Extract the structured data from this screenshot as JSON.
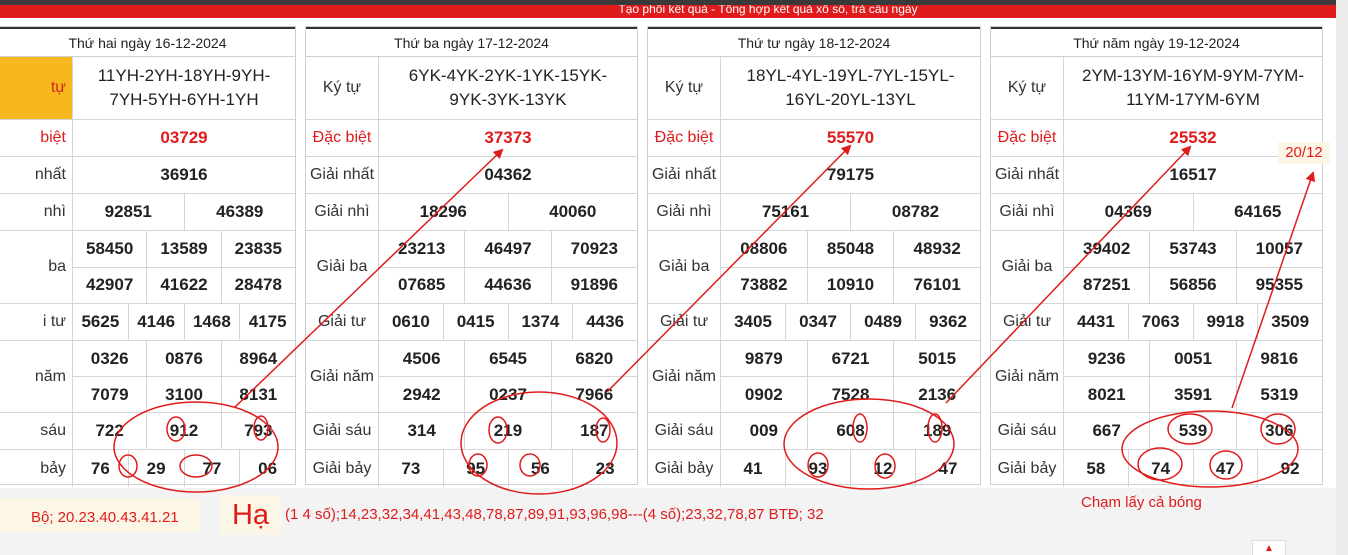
{
  "header": {
    "banner_text": "Tạo phôi kết quả - Tổng hợp kết quả xổ số, trả cầu ngày"
  },
  "labels": {
    "ky_tu": "Ký tự",
    "dac_biet": "Đặc biệt",
    "giai_nhat": "Giải nhất",
    "giai_nhi": "Giải nhì",
    "giai_ba": "Giải ba",
    "giai_tu": "Giải tư",
    "giai_nam": "Giải năm",
    "giai_sau": "Giải sáu",
    "giai_bay": "Giải bảy"
  },
  "first_labels": {
    "ky_tu": "tự",
    "dac_biet": "biệt",
    "giai_nhat": "nhất",
    "giai_nhi": "nhì",
    "giai_ba": "ba",
    "giai_tu": "i tư",
    "giai_nam": "năm",
    "giai_sau": "sáu",
    "giai_bay": "bảy"
  },
  "cards": [
    {
      "date": "Thứ hai ngày 16-12-2024",
      "ky_tu": "11YH-2YH-18YH-9YH-7YH-5YH-6YH-1YH",
      "dac_biet": "03729",
      "giai_nhat": "36916",
      "giai_nhi": [
        "92851",
        "46389"
      ],
      "giai_ba": [
        "58450",
        "13589",
        "23835",
        "42907",
        "41622",
        "28478"
      ],
      "giai_tu": [
        "5625",
        "4146",
        "1468",
        "4175"
      ],
      "giai_nam": [
        "0326",
        "0876",
        "8964",
        "7079",
        "3100",
        "8131"
      ],
      "giai_sau": [
        "722",
        "912",
        "793"
      ],
      "giai_bay": [
        "76",
        "29",
        "77",
        "06"
      ]
    },
    {
      "date": "Thứ ba ngày 17-12-2024",
      "ky_tu": "6YK-4YK-2YK-1YK-15YK-9YK-3YK-13YK",
      "dac_biet": "37373",
      "giai_nhat": "04362",
      "giai_nhi": [
        "18296",
        "40060"
      ],
      "giai_ba": [
        "23213",
        "46497",
        "70923",
        "07685",
        "44636",
        "91896"
      ],
      "giai_tu": [
        "0610",
        "0415",
        "1374",
        "4436"
      ],
      "giai_nam": [
        "4506",
        "6545",
        "6820",
        "2942",
        "0237",
        "7966"
      ],
      "giai_sau": [
        "314",
        "219",
        "187"
      ],
      "giai_bay": [
        "73",
        "95",
        "56",
        "23"
      ]
    },
    {
      "date": "Thứ tư ngày 18-12-2024",
      "ky_tu": "18YL-4YL-19YL-7YL-15YL-16YL-20YL-13YL",
      "dac_biet": "55570",
      "giai_nhat": "79175",
      "giai_nhi": [
        "75161",
        "08782"
      ],
      "giai_ba": [
        "08806",
        "85048",
        "48932",
        "73882",
        "10910",
        "76101"
      ],
      "giai_tu": [
        "3405",
        "0347",
        "0489",
        "9362"
      ],
      "giai_nam": [
        "9879",
        "6721",
        "5015",
        "0902",
        "7528",
        "2136"
      ],
      "giai_sau": [
        "009",
        "608",
        "189"
      ],
      "giai_bay": [
        "41",
        "93",
        "12",
        "47"
      ]
    },
    {
      "date": "Thứ năm ngày 19-12-2024",
      "ky_tu": "2YM-13YM-16YM-9YM-7YM-11YM-17YM-6YM",
      "dac_biet": "25532",
      "giai_nhat": "16517",
      "giai_nhi": [
        "04369",
        "64165"
      ],
      "giai_ba": [
        "39402",
        "53743",
        "10057",
        "87251",
        "56856",
        "95355"
      ],
      "giai_tu": [
        "4431",
        "7063",
        "9918",
        "3509"
      ],
      "giai_nam": [
        "9236",
        "0051",
        "9816",
        "8021",
        "3591",
        "5319"
      ],
      "giai_sau": [
        "667",
        "539",
        "306"
      ],
      "giai_bay": [
        "58",
        "74",
        "47",
        "92"
      ]
    }
  ],
  "annotations": {
    "date_label": "20/12",
    "bo": "Bộ; 20.23.40.43.41.21",
    "ha": "Hạ",
    "list": "(1 4 số);14,23,32,34,41,43,48,78,87,89,91,93,96,98---(4 số);23,32,78,87 BTĐ; 32",
    "cham": "Chạm lấy cả bóng"
  },
  "colors": {
    "accent_red": "#e01b1b",
    "highlight_yellow": "#f6b81c",
    "note_bg": "#fbf6e6"
  },
  "icons": {
    "scroll_top": "chevron-up-icon"
  }
}
